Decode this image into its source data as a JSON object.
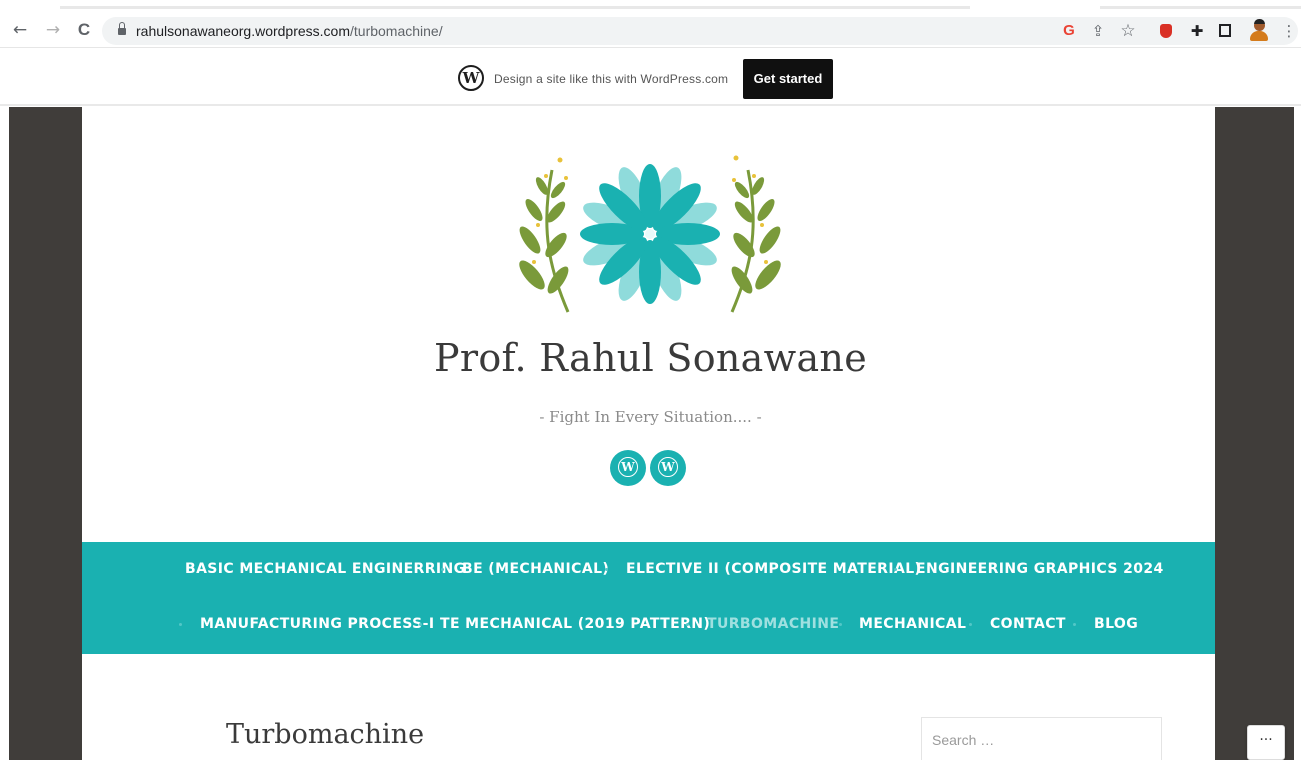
{
  "browser": {
    "url_host": "rahulsonawaneorg.wordpress.com",
    "url_path": "/turbomachine/",
    "back_icon": "←",
    "forward_icon": "→",
    "reload_icon": "C",
    "google_icon": "G",
    "share_icon": "⇪",
    "star_icon": "☆",
    "puzzle_icon": "✚",
    "menu_icon": "⋮"
  },
  "wp_banner": {
    "logo": "W",
    "text": "Design a site like this with WordPress.com",
    "button_label": "Get started"
  },
  "site": {
    "title": "Prof. Rahul Sonawane",
    "tagline": "- Fight In Every Situation.... -",
    "social": [
      "W",
      "W"
    ]
  },
  "menu": {
    "row1": [
      "BASIC MECHANICAL ENGINERRING",
      "BE (MECHANICAL)",
      "ELECTIVE II (COMPOSITE MATERIAL)",
      "ENGINEERING GRAPHICS 2024"
    ],
    "row2": [
      "MANUFACTURING PROCESS-I",
      "TE MECHANICAL (2019 PATTERN)",
      "TURBOMACHINE",
      "MECHANICAL",
      "CONTACT",
      "BLOG"
    ],
    "current": "TURBOMACHINE"
  },
  "page": {
    "title": "Turbomachine"
  },
  "search": {
    "placeholder": "Search …"
  },
  "more_button": "···",
  "colors": {
    "accent": "#1ab1b1",
    "frame": "#403d3a",
    "leaf_green": "#7a9a3a",
    "petal_light": "#8fdbdb",
    "petal_dark": "#1ab1b1"
  }
}
